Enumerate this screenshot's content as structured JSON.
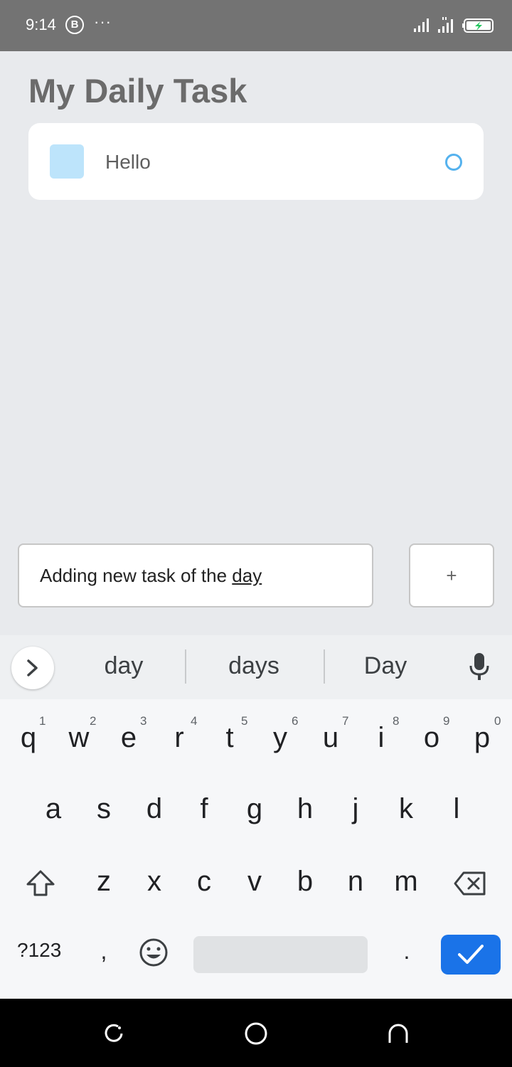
{
  "status_bar": {
    "time": "9:14",
    "b_badge": "B",
    "more": "···",
    "battery_state": "charging"
  },
  "app": {
    "title": "My Daily Task",
    "tasks": [
      {
        "text": "Hello",
        "square_color": "#BDE4FB",
        "status_color": "#55B2EE"
      }
    ],
    "input": {
      "value_prefix": "Adding new task of the ",
      "value_underlined": "day"
    },
    "add_label": "+"
  },
  "keyboard": {
    "suggestions": [
      "day",
      "days",
      "Day"
    ],
    "row1": [
      "q",
      "w",
      "e",
      "r",
      "t",
      "y",
      "u",
      "i",
      "o",
      "p"
    ],
    "row1_hints": [
      "1",
      "2",
      "3",
      "4",
      "5",
      "6",
      "7",
      "8",
      "9",
      "0"
    ],
    "row2": [
      "a",
      "s",
      "d",
      "f",
      "g",
      "h",
      "j",
      "k",
      "l"
    ],
    "row3": [
      "z",
      "x",
      "c",
      "v",
      "b",
      "n",
      "m"
    ],
    "symbols_label": "?123",
    "comma": ",",
    "period": ".",
    "enter_color": "#1A73E8"
  }
}
